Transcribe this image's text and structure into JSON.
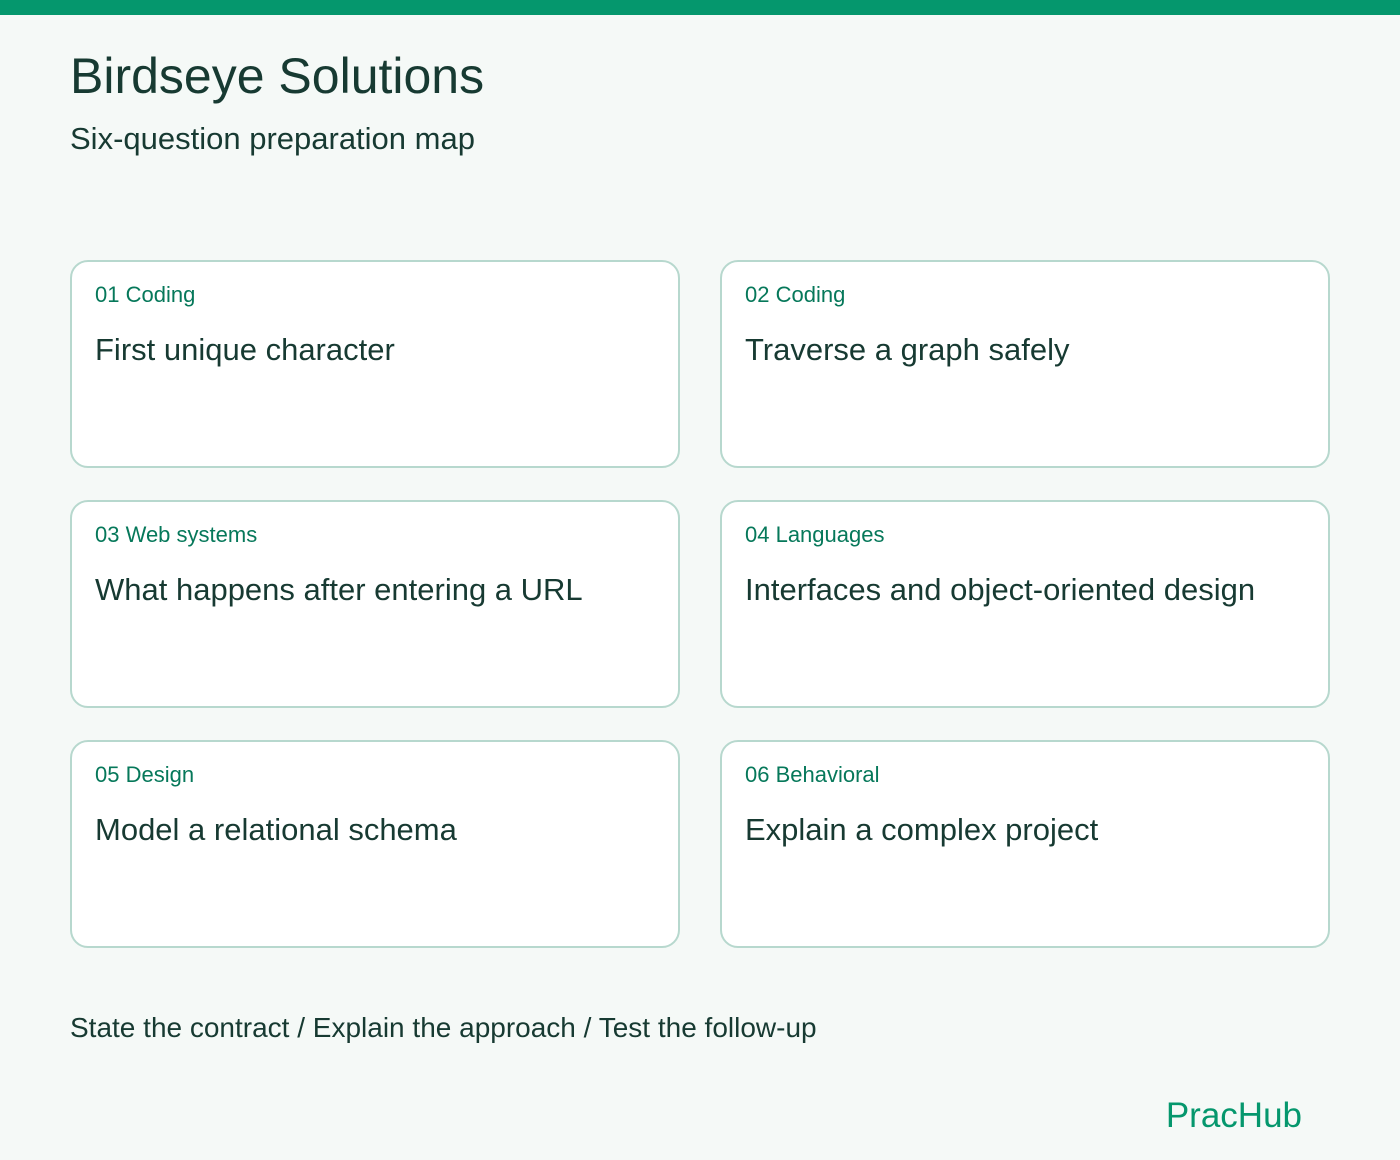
{
  "header": {
    "title": "Birdseye Solutions",
    "subtitle": "Six-question preparation map"
  },
  "cards": [
    {
      "tag": "01 Coding",
      "title": "First unique character"
    },
    {
      "tag": "02 Coding",
      "title": "Traverse a graph safely"
    },
    {
      "tag": "03 Web systems",
      "title": "What happens after entering a URL"
    },
    {
      "tag": "04 Languages",
      "title": "Interfaces and object-oriented design"
    },
    {
      "tag": "05 Design",
      "title": "Model a relational schema"
    },
    {
      "tag": "06 Behavioral",
      "title": "Explain a complex project"
    }
  ],
  "footer": {
    "steps": "State the contract / Explain the approach / Test the follow-up",
    "brand": "PracHub"
  },
  "colors": {
    "accent": "#05976d",
    "tag_text": "#06785a",
    "text": "#173a32",
    "card_border": "#b7d8ce",
    "background": "#f5f9f7"
  }
}
